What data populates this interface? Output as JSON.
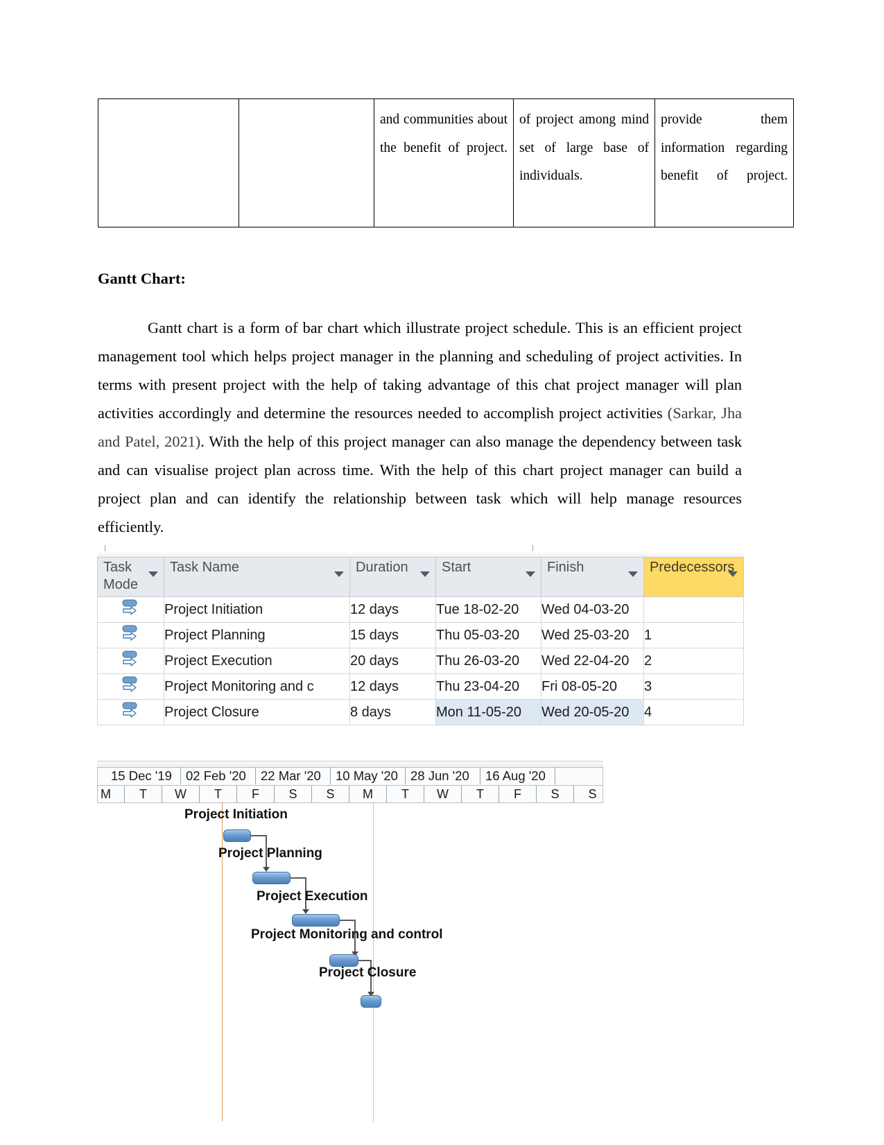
{
  "top_table": {
    "rows": [
      {
        "cells": [
          {
            "text": ""
          },
          {
            "text": ""
          },
          {
            "text": "and communities about the benefit of project."
          },
          {
            "text": "of project among mind set of large base of individuals."
          },
          {
            "text": "provide them information regarding benefit of project."
          }
        ]
      }
    ]
  },
  "heading": "Gantt Chart:",
  "paragraph": {
    "part1": "Gantt chart is a form of bar chart which illustrate project schedule. This is an efficient project management tool which helps project manager in the planning and scheduling of project activities. In terms with present project with the help of taking advantage of this chat project manager will plan activities accordingly and determine the resources needed to accomplish project activities ",
    "citation": "(Sarkar, Jha and Patel,  2021)",
    "part2": ". With the help of this project manager can also manage the dependency between task and can visualise project plan across time. With the help of this chart project manager can build a project plan and can identify the relationship between task which will help manage resources efficiently."
  },
  "project_table": {
    "columns": [
      {
        "label": "Task Mode",
        "icon": "filter-arrow",
        "highlight": false
      },
      {
        "label": "Task Name",
        "icon": "filter-arrow",
        "highlight": false
      },
      {
        "label": "Duration",
        "icon": "filter-arrow",
        "highlight": false
      },
      {
        "label": "Start",
        "icon": "filter-arrow",
        "highlight": false
      },
      {
        "label": "Finish",
        "icon": "filter-arrow",
        "highlight": false
      },
      {
        "label": "Predecessors",
        "icon": "filter-arrow",
        "highlight": true
      }
    ],
    "rows": [
      {
        "mode": "auto-scheduled",
        "name": "Project Initiation",
        "duration": "12 days",
        "start": "Tue 18-02-20",
        "finish": "Wed 04-03-20",
        "predecessors": ""
      },
      {
        "mode": "auto-scheduled",
        "name": "Project Planning",
        "duration": "15 days",
        "start": "Thu 05-03-20",
        "finish": "Wed 25-03-20",
        "predecessors": "1"
      },
      {
        "mode": "auto-scheduled",
        "name": "Project Execution",
        "duration": "20 days",
        "start": "Thu 26-03-20",
        "finish": "Wed 22-04-20",
        "predecessors": "2"
      },
      {
        "mode": "auto-scheduled",
        "name": "Project Monitoring and c",
        "duration": "12 days",
        "start": "Thu 23-04-20",
        "finish": "Fri 08-05-20",
        "predecessors": "3"
      },
      {
        "mode": "auto-scheduled",
        "name": "Project Closure",
        "duration": "8 days",
        "start": "Mon 11-05-20",
        "finish": "Wed 20-05-20",
        "predecessors": "4"
      }
    ]
  },
  "chart_data": {
    "type": "bar",
    "title": "Gantt Chart",
    "xlabel": "",
    "ylabel": "",
    "timescale": {
      "major_ticks": [
        "15 Dec '19",
        "02 Feb '20",
        "22 Mar '20",
        "10 May '20",
        "28 Jun '20",
        "16 Aug '20"
      ],
      "minor_ticks": [
        "M",
        "T",
        "W",
        "T",
        "F",
        "S",
        "S",
        "M",
        "T",
        "W",
        "T",
        "F",
        "S",
        "S"
      ]
    },
    "tasks": [
      {
        "name": "Project Initiation",
        "duration_days": 12,
        "start": "Tue 18-02-20",
        "finish": "Wed 04-03-20",
        "predecessor": ""
      },
      {
        "name": "Project Planning",
        "duration_days": 15,
        "start": "Thu 05-03-20",
        "finish": "Wed 25-03-20",
        "predecessor": "1"
      },
      {
        "name": "Project Execution",
        "duration_days": 20,
        "start": "Thu 26-03-20",
        "finish": "Wed 22-04-20",
        "predecessor": "2"
      },
      {
        "name": "Project Monitoring and control",
        "duration_days": 12,
        "start": "Thu 23-04-20",
        "finish": "Fri 08-05-20",
        "predecessor": "3"
      },
      {
        "name": "Project Closure",
        "duration_days": 8,
        "start": "Mon 11-05-20",
        "finish": "Wed 20-05-20",
        "predecessor": "4"
      }
    ],
    "bar_labels": [
      "Project Initiation",
      "Project Planning",
      "Project Execution",
      "Project Monitoring and control",
      "Project Closure"
    ],
    "colors": {
      "bar_fill": "#6a9bd0",
      "bar_border": "#3f6f9f",
      "today_line": "#e09b50",
      "status_line": "#8a8a8a",
      "header_highlight": "#ffd966"
    },
    "grid": true,
    "legend": "none"
  }
}
